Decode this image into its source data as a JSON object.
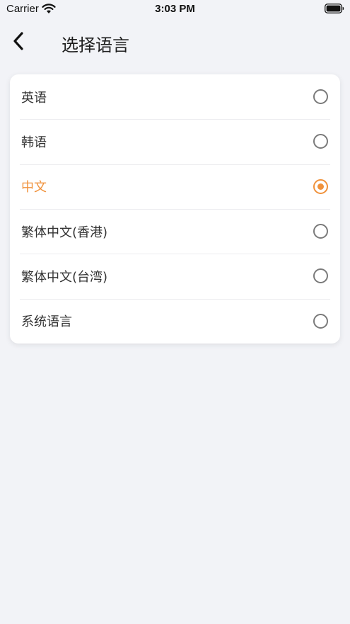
{
  "status_bar": {
    "carrier": "Carrier",
    "time": "3:03 PM"
  },
  "nav": {
    "title": "选择语言",
    "back_icon": "chevron-left-icon"
  },
  "colors": {
    "accent": "#f0923c",
    "background": "#f2f3f7",
    "card": "#ffffff"
  },
  "languages": [
    {
      "label": "英语",
      "selected": false
    },
    {
      "label": "韩语",
      "selected": false
    },
    {
      "label": "中文",
      "selected": true
    },
    {
      "label": "繁体中文(香港)",
      "selected": false
    },
    {
      "label": "繁体中文(台湾)",
      "selected": false
    },
    {
      "label": "系统语言",
      "selected": false
    }
  ]
}
